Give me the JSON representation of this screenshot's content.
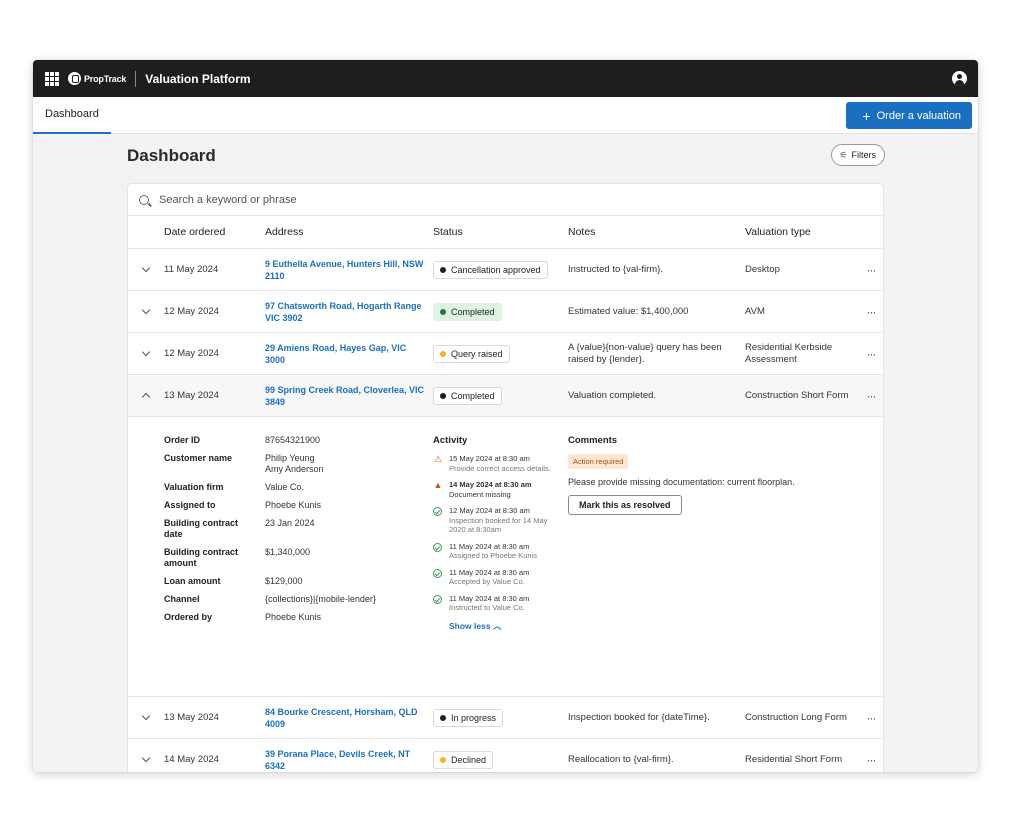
{
  "topbar": {
    "brand": "PropTrack",
    "app_title": "Valuation Platform"
  },
  "tabs": [
    {
      "label": "Dashboard"
    }
  ],
  "order_button": {
    "label": "Order a valuation"
  },
  "page": {
    "title": "Dashboard",
    "filters_label": "Filters"
  },
  "search": {
    "placeholder": "Search a keyword or phrase"
  },
  "table": {
    "headers": {
      "date": "Date ordered",
      "address": "Address",
      "status": "Status",
      "notes": "Notes",
      "type": "Valuation type"
    },
    "rows": [
      {
        "date": "11 May 2024",
        "address": "9 Euthella Avenue, Hunters Hill, NSW 2110",
        "status": "Cancellation approved",
        "status_color": "#1e1e1e",
        "notes": "Instructed to {val-firm}.",
        "type": "Desktop"
      },
      {
        "date": "12 May 2024",
        "address": "97 Chatsworth Road, Hogarth Range VIC 3902",
        "status": "Completed",
        "status_color": "#1e7a3c",
        "notes": "Estimated value: $1,400,000",
        "type": "AVM"
      },
      {
        "date": "12 May 2024",
        "address": "29 Amiens Road, Hayes Gap, VIC 3000",
        "status": "Query raised",
        "status_color": "#f0b429",
        "notes": "A {value}{non-value} query has been raised by {lender}.",
        "type": "Residential Kerbside Assessment"
      },
      {
        "date": "13 May 2024",
        "address": "99 Spring Creek Road, Cloverlea, VIC 3849",
        "status": "Completed",
        "status_color": "#1e1e1e",
        "notes": "Valuation completed.",
        "type": "Construction Short Form"
      },
      {
        "date": "13 May 2024",
        "address": "84 Bourke Crescent, Horsham, QLD 4009",
        "status": "In progress",
        "status_color": "#1e1e1e",
        "notes": "Inspection booked for {dateTime}.",
        "type": "Construction Long Form"
      },
      {
        "date": "14 May 2024",
        "address": "39 Porana Place, Devils Creek, NT 6342",
        "status": "Declined",
        "status_color": "#f0b429",
        "notes": "Reallocation to {val-firm}.",
        "type": "Residential Short Form"
      }
    ]
  },
  "detail": {
    "info": [
      {
        "label": "Order ID",
        "value": "87654321900"
      },
      {
        "label": "Customer name",
        "value": "Philip Yeung",
        "value2": "Amy Anderson"
      },
      {
        "label": "Valuation firm",
        "value": "Value Co."
      },
      {
        "label": "Assigned to",
        "value": "Phoebe Kunis"
      },
      {
        "label": "Building contract",
        "label2": "date",
        "value": "23 Jan 2024"
      },
      {
        "label": "Building contract",
        "label2": "amount",
        "value": "$1,340,000"
      },
      {
        "label": "Loan amount",
        "value": "$129,000"
      },
      {
        "label": "Channel",
        "value": "{collections}|{mobile-lender}"
      },
      {
        "label": "Ordered by",
        "value": "Phoebe Kunis"
      }
    ],
    "activity_heading": "Activity",
    "activity": [
      {
        "icon": "warning-outline-icon",
        "time": "15 May 2024 at 8:30 am",
        "desc": "Provide correct access details."
      },
      {
        "icon": "warning-filled-icon",
        "time": "14 May 2024 at 8:30 am",
        "desc": "Document missing"
      },
      {
        "icon": "check-circle-icon",
        "time": "12 May 2024 at 8:30 am",
        "desc": "Inspection booked for 14 May 2020 at 8:30am"
      },
      {
        "icon": "check-circle-icon",
        "time": "11 May 2024 at 8:30 am",
        "desc": "Assigned to Phoebe Kunis"
      },
      {
        "icon": "check-circle-icon",
        "time": "11 May 2024 at 8:30 am",
        "desc": "Accepted by Value Co."
      },
      {
        "icon": "check-circle-icon",
        "time": "11 May 2024 at 8:30 am",
        "desc": "Instructed to Value Co."
      }
    ],
    "show_less": "Show less",
    "comments_heading": "Comments",
    "action_badge": "Action required",
    "comment": "Please provide missing documentation: current floorplan.",
    "resolve_button": "Mark this as resolved"
  }
}
